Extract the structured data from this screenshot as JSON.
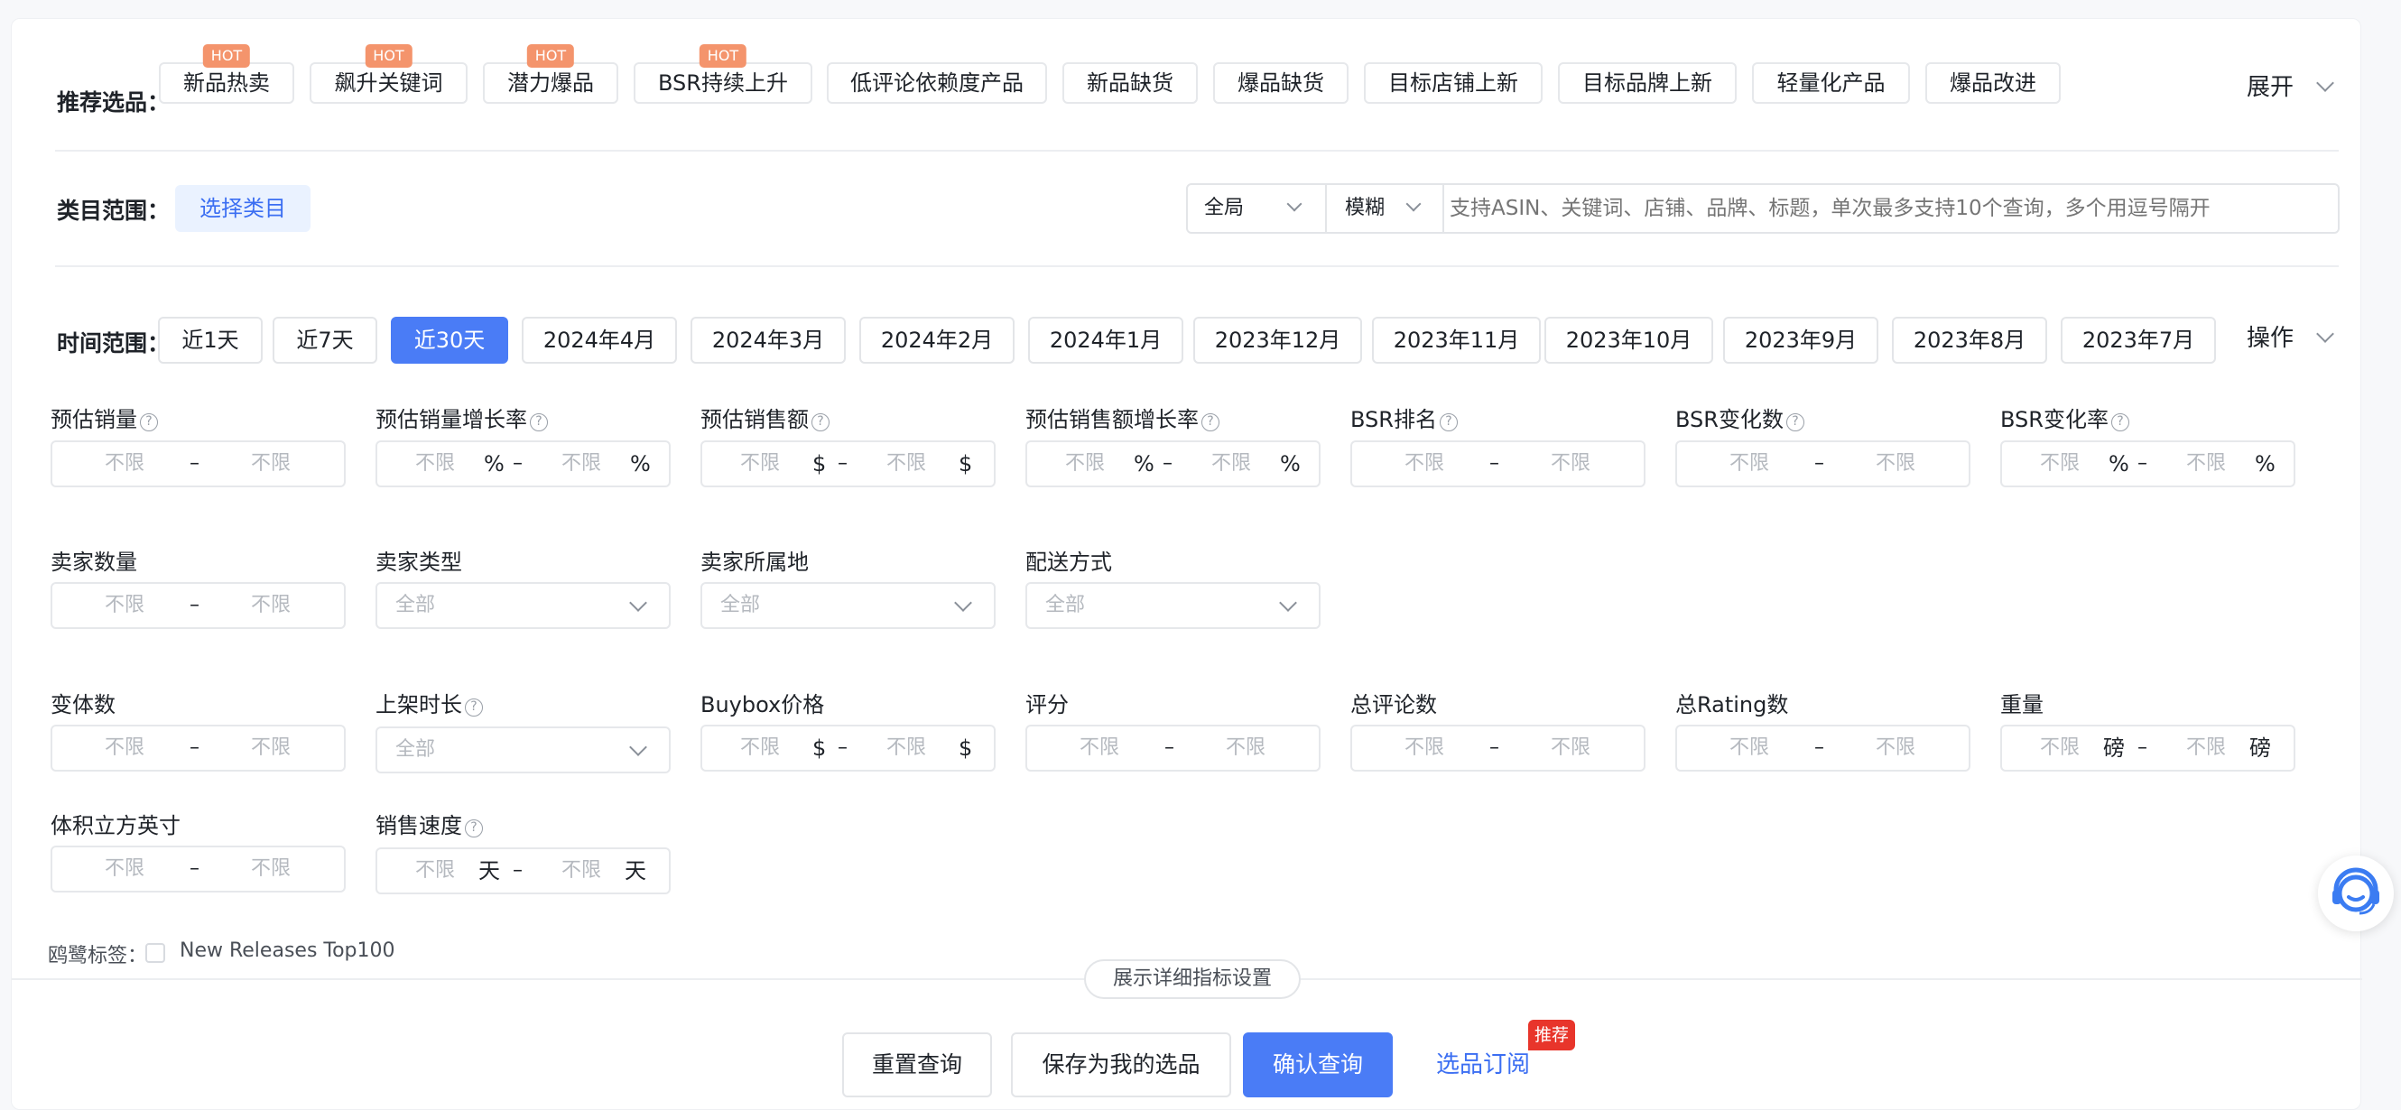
{
  "recommend": {
    "label": "推荐选品：",
    "hot_badge": "HOT",
    "chips": [
      {
        "label": "新品热卖",
        "hot": true
      },
      {
        "label": "飙升关键词",
        "hot": true
      },
      {
        "label": "潜力爆品",
        "hot": true
      },
      {
        "label": "BSR持续上升",
        "hot": true
      },
      {
        "label": "低评论依赖度产品",
        "hot": false
      },
      {
        "label": "新品缺货",
        "hot": false
      },
      {
        "label": "爆品缺货",
        "hot": false
      },
      {
        "label": "目标店铺上新",
        "hot": false
      },
      {
        "label": "目标品牌上新",
        "hot": false
      },
      {
        "label": "轻量化产品",
        "hot": false
      },
      {
        "label": "爆品改进",
        "hot": false
      }
    ],
    "expand_label": "展开"
  },
  "category": {
    "label": "类目范围：",
    "select_button": "选择类目"
  },
  "search": {
    "scope": "全局",
    "match": "模糊",
    "placeholder": "支持ASIN、关键词、店铺、品牌、标题，单次最多支持10个查询，多个用逗号隔开"
  },
  "time": {
    "label": "时间范围：",
    "options": [
      "近1天",
      "近7天",
      "近30天",
      "2024年4月",
      "2024年3月",
      "2024年2月",
      "2024年1月",
      "2023年12月",
      "2023年11月",
      "2023年10月",
      "2023年9月",
      "2023年8月",
      "2023年7月"
    ],
    "active_option": "近30天",
    "operate_label": "操作"
  },
  "filters": {
    "placeholder": "不限",
    "dash": "–",
    "select_placeholder": "全部",
    "help_glyph": "?",
    "fields": {
      "est_sales": {
        "label": "预估销量"
      },
      "est_sales_growth": {
        "label": "预估销量增长率",
        "unit": "%"
      },
      "est_revenue": {
        "label": "预估销售额",
        "unit": "$"
      },
      "est_revenue_growth": {
        "label": "预估销售额增长率",
        "unit": "%"
      },
      "bsr_rank": {
        "label": "BSR排名"
      },
      "bsr_change": {
        "label": "BSR变化数"
      },
      "bsr_change_rate": {
        "label": "BSR变化率",
        "unit": "%"
      },
      "seller_count": {
        "label": "卖家数量"
      },
      "seller_type": {
        "label": "卖家类型"
      },
      "seller_location": {
        "label": "卖家所属地"
      },
      "delivery": {
        "label": "配送方式"
      },
      "variants": {
        "label": "变体数"
      },
      "listing_age": {
        "label": "上架时长"
      },
      "buybox_price": {
        "label": "Buybox价格",
        "unit": "$"
      },
      "rating": {
        "label": "评分"
      },
      "total_reviews": {
        "label": "总评论数"
      },
      "total_ratings": {
        "label": "总Rating数"
      },
      "weight": {
        "label": "重量",
        "unit": "磅"
      },
      "volume": {
        "label": "体积立方英寸"
      },
      "sales_velocity": {
        "label": "销售速度",
        "unit": "天"
      }
    }
  },
  "heron": {
    "label": "鸥鹭标签：",
    "option": "New Releases Top100",
    "checked": false
  },
  "detail_toggle": "展示详细指标设置",
  "actions": {
    "reset": "重置查询",
    "save": "保存为我的选品",
    "confirm": "确认查询",
    "subscribe": "选品订阅",
    "subscribe_badge": "推荐"
  },
  "colors": {
    "primary": "#4a7cf6",
    "hot": "#f4946c",
    "badge_red": "#e8352b",
    "link": "#3b6ef2"
  }
}
